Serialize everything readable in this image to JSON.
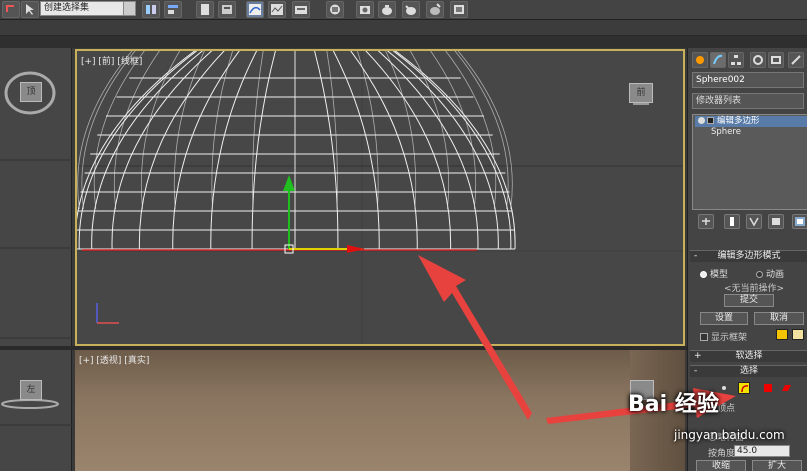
{
  "toolbar": {
    "selection_set": "创建选择集",
    "buttons": [
      "undo-icon",
      "cursor-icon",
      "mirror-icon",
      "align-icon",
      "layer-icon",
      "ribbon-icon",
      "curve-editor-icon",
      "schematic-icon",
      "material-editor-icon",
      "render-setup-icon",
      "render-frame-icon",
      "render-icon",
      "active-shade-icon"
    ]
  },
  "viewports": {
    "front_label": "[+] [前] [线框]",
    "perspective_label": "[+] [透视] [真实]",
    "viewcube_front": "前",
    "viewcube_top": "顶",
    "viewcube_left": "左"
  },
  "command_panel": {
    "object_name": "Sphere002",
    "modifier_list": "修改器列表",
    "stack": [
      {
        "label": "编辑多边形",
        "selected": true
      },
      {
        "label": "Sphere",
        "selected": false
      }
    ],
    "edit_poly_mode": {
      "title": "编辑多边形模式",
      "mode_model": "模型",
      "mode_animate": "动画",
      "no_op": "<无当前操作>",
      "commit": "提交",
      "settings": "设置",
      "cancel": "取消",
      "show_cage": "显示框架"
    },
    "soft_selection_title": "软选择",
    "selection_title": "选择",
    "by_vertex_partial": "按顶点",
    "ignore_backfacing": "忽略背面",
    "by_angle_label": "按角度:",
    "angle_value": "45.0",
    "shrink": "收缩",
    "grow": "扩大"
  },
  "watermark": {
    "logo": "Bai 经验",
    "url": "jingyan.baidu.com"
  },
  "colors": {
    "active_viewport_border": "#c9b05a",
    "stack_selected": "#587ba8",
    "cage_color_1": "#f5c400",
    "cage_color_2": "#f2e0a0",
    "annotation_arrow": "#e8423f"
  }
}
